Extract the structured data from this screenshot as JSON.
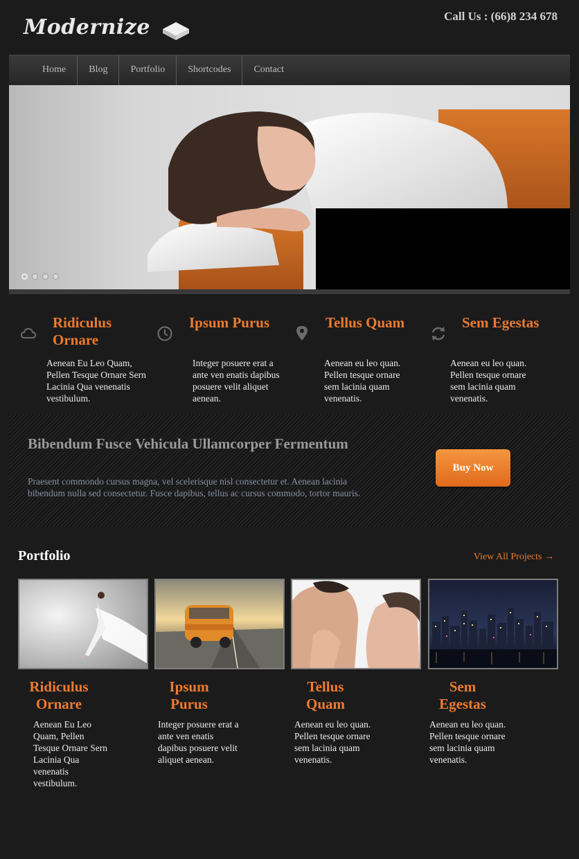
{
  "header": {
    "logo_text": "Modernize",
    "call_us": "Call Us : (66)8 234 678"
  },
  "nav": {
    "items": [
      "Home",
      "Blog",
      "Portfolio",
      "Shortcodes",
      "Contact"
    ]
  },
  "slider": {
    "dot_count": 4,
    "active_dot": 1
  },
  "features": [
    {
      "icon": "cloud-icon",
      "title": "Ridiculus Ornare",
      "text": "Aenean Eu Leo Quam, Pellen Tesque Ornare Sern Lacinia Qua venenatis vestibulum."
    },
    {
      "icon": "clock-icon",
      "title": "Ipsum Purus",
      "text": "Integer posuere erat a ante ven enatis dapibus posuere velit aliquet aenean."
    },
    {
      "icon": "map-pin-icon",
      "title": "Tellus Quam",
      "text": "Aenean eu leo quan. Pellen tesque ornare sem lacinia quam venenatis."
    },
    {
      "icon": "refresh-icon",
      "title": "Sem Egestas",
      "text": "Aenean eu leo quan. Pellen tesque ornare sem lacinia quam venenatis."
    }
  ],
  "promo": {
    "title": "Bibendum Fusce Vehicula Ullamcorper Fermentum",
    "text": "Praesent commondo cursus magna, vel scelerisque nisl consectetur et. Aenean lacinia bibendum nulla sed consectetur. Fusce dapibus, tellus ac cursus commodo, tortor mauris.",
    "button": "Buy Now"
  },
  "portfolio": {
    "title": "Portfolio",
    "view_all": "View All Projects →",
    "items": [
      {
        "title": "Ridiculus Ornare",
        "text": "Aenean Eu Leo Quam, Pellen Tesque Ornare Sern Lacinia Qua venenatis vestibulum."
      },
      {
        "title": "Ipsum Purus",
        "text": "Integer posuere erat a ante ven enatis dapibus posuere velit aliquet aenean."
      },
      {
        "title": "Tellus Quam",
        "text": "Aenean eu leo quan. Pellen tesque ornare sem lacinia quam venenatis."
      },
      {
        "title": "Sem Egestas",
        "text": "Aenean eu leo quan. Pellen tesque ornare sem lacinia quam venenatis."
      }
    ]
  },
  "colors": {
    "accent": "#ee7a2f",
    "background": "#1b1b1b",
    "nav": "#2e2e2e"
  }
}
